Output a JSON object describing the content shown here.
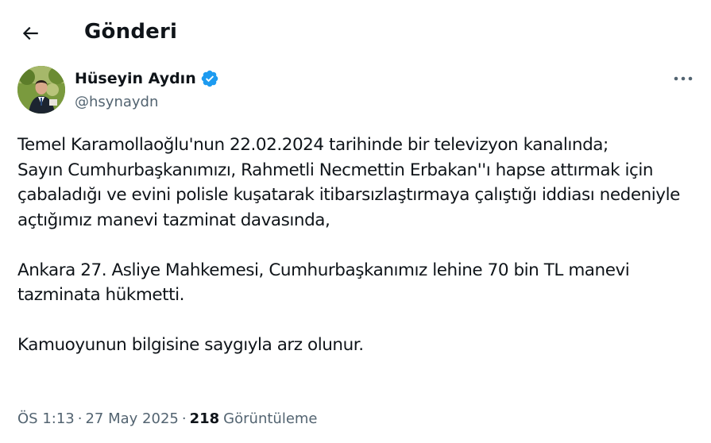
{
  "header": {
    "title": "Gönderi",
    "back_icon": "arrow-left-icon"
  },
  "author": {
    "display_name": "Hüseyin Aydın",
    "handle": "@hsynaydn",
    "verified_icon": "verified-badge-icon",
    "more_icon": "more-horizontal-icon"
  },
  "post": {
    "text": "Temel Karamollaoğlu'nun 22.02.2024 tarihinde bir televizyon kanalında;\nSayın Cumhurbaşkanımızı, Rahmetli Necmettin Erbakan''ı hapse attırmak için çabaladığı ve  evini polisle kuşatarak itibarsızlaştırmaya çalıştığı iddiası nedeniyle açtığımız manevi tazminat davasında,\n\nAnkara 27. Asliye Mahkemesi,  Cumhurbaşkanımız lehine 70 bin TL manevi tazminata hükmetti.\n\nKamuoyunun bilgisine saygıyla arz olunur."
  },
  "meta": {
    "time": "ÖS 1:13",
    "separator": "·",
    "date": "27 May 2025",
    "views_count": "218",
    "views_label": "Görüntüleme"
  },
  "colors": {
    "text_primary": "#0f1419",
    "text_secondary": "#536471",
    "verified_blue": "#1d9bf0",
    "background": "#ffffff"
  }
}
